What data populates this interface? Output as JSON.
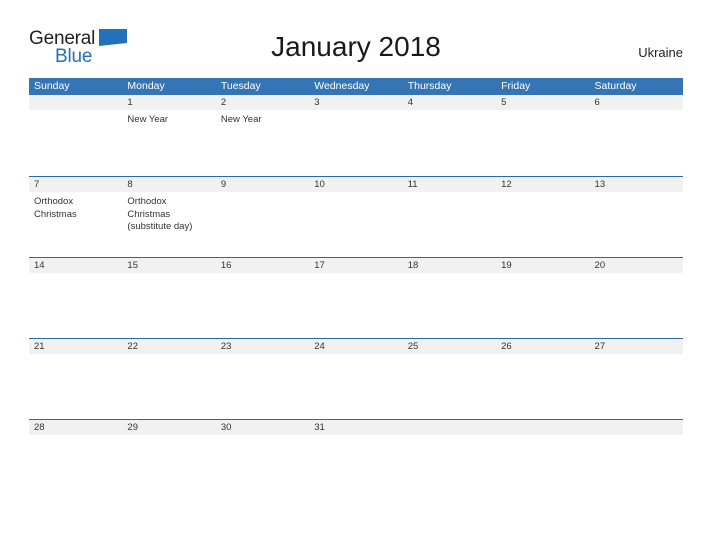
{
  "brand": {
    "name_part1": "General",
    "name_part2": "Blue",
    "flag_icon": "flag-triangle-icon",
    "color_dark": "#231f20",
    "color_blue": "#2272b9"
  },
  "header": {
    "title": "January 2018",
    "region": "Ukraine"
  },
  "calendar": {
    "header_color": "#3575b5",
    "band_color": "#f1f1f1",
    "rule_color": "#2a6aa8",
    "weekdays": [
      "Sunday",
      "Monday",
      "Tuesday",
      "Wednesday",
      "Thursday",
      "Friday",
      "Saturday"
    ],
    "weeks": [
      {
        "days": [
          {
            "date": "",
            "events": []
          },
          {
            "date": "1",
            "events": [
              "New Year"
            ]
          },
          {
            "date": "2",
            "events": [
              "New Year"
            ]
          },
          {
            "date": "3",
            "events": []
          },
          {
            "date": "4",
            "events": []
          },
          {
            "date": "5",
            "events": []
          },
          {
            "date": "6",
            "events": []
          }
        ]
      },
      {
        "days": [
          {
            "date": "7",
            "events": [
              "Orthodox",
              "Christmas"
            ]
          },
          {
            "date": "8",
            "events": [
              "Orthodox",
              "Christmas",
              "(substitute day)"
            ]
          },
          {
            "date": "9",
            "events": []
          },
          {
            "date": "10",
            "events": []
          },
          {
            "date": "11",
            "events": []
          },
          {
            "date": "12",
            "events": []
          },
          {
            "date": "13",
            "events": []
          }
        ]
      },
      {
        "days": [
          {
            "date": "14",
            "events": []
          },
          {
            "date": "15",
            "events": []
          },
          {
            "date": "16",
            "events": []
          },
          {
            "date": "17",
            "events": []
          },
          {
            "date": "18",
            "events": []
          },
          {
            "date": "19",
            "events": []
          },
          {
            "date": "20",
            "events": []
          }
        ]
      },
      {
        "days": [
          {
            "date": "21",
            "events": []
          },
          {
            "date": "22",
            "events": []
          },
          {
            "date": "23",
            "events": []
          },
          {
            "date": "24",
            "events": []
          },
          {
            "date": "25",
            "events": []
          },
          {
            "date": "26",
            "events": []
          },
          {
            "date": "27",
            "events": []
          }
        ]
      },
      {
        "days": [
          {
            "date": "28",
            "events": []
          },
          {
            "date": "29",
            "events": []
          },
          {
            "date": "30",
            "events": []
          },
          {
            "date": "31",
            "events": []
          },
          {
            "date": "",
            "events": []
          },
          {
            "date": "",
            "events": []
          },
          {
            "date": "",
            "events": []
          }
        ]
      }
    ]
  }
}
